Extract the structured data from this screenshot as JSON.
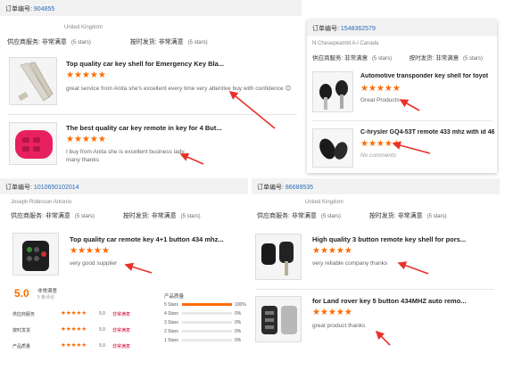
{
  "star_glyph": "★★★★★",
  "accent_color": "#ff6a00",
  "link_color": "#2a6bb8",
  "orders": [
    {
      "order_label": "订单编号:",
      "order_number": "904855",
      "seller": "United Kingdom",
      "service_label": "供应商服务:",
      "service_value": "非常满意",
      "service_stars": "(5 stars)",
      "delivery_label": "按时发货:",
      "delivery_value": "非常满意",
      "delivery_stars": "(5 stars)",
      "items": [
        {
          "title": "Top quality car key shell for Emergency Key Bla...",
          "comment": "great service from Anita she's excellent every time very attentive buy with confidence 😊",
          "thumb_icon": "key-blade-icon"
        },
        {
          "title": "The best quality car key remote in key for 4 But...",
          "comment": "I buy from Anita she is excellent business lady",
          "comment2": "many thanks",
          "thumb_icon": "silicone-key-cover-icon"
        }
      ]
    },
    {
      "order_label": "订单编号:",
      "order_number": "15483625",
      "order_suffix": "79",
      "seller": "N Chesepeambl A-l Canada",
      "service_label": "供应商服务:",
      "service_value": "非常满意",
      "service_stars": "(5 stars)",
      "delivery_label": "按时发货:",
      "delivery_value": "非常满意",
      "delivery_stars": "(5 stars)",
      "items": [
        {
          "title": "Automotive transponder key shell for toyot",
          "comment": "Great Products",
          "thumb_icon": "transponder-key-icon"
        },
        {
          "title": "C-hrysler GQ4-53T remote 433 mhz with id 46 ...",
          "comment": "No comments",
          "thumb_icon": "fob-remote-icon"
        }
      ]
    },
    {
      "order_label": "订单编号:",
      "order_number": "1",
      "order_rest": "01065010201",
      "order_suffix": "4",
      "seller": "Joseph Robinson Antonio",
      "service_label": "供应商服务:",
      "service_value": "非常满意",
      "service_stars": "(5 stars)",
      "delivery_label": "按时发货:",
      "delivery_value": "非常满意",
      "delivery_stars": "(5 stars)",
      "items": [
        {
          "title": "Top quality car remote key 4+1 button 434 mhz...",
          "comment": "very good supplier",
          "thumb_icon": "flip-remote-key-icon"
        }
      ]
    },
    {
      "order_label": "订单编号:",
      "order_number": "86689535",
      "seller": "United Kingdom",
      "service_label": "供应商服务:",
      "service_value": "非常满意",
      "service_stars": "(5 stars)",
      "delivery_label": "按时发货:",
      "delivery_value": "非常满意",
      "delivery_stars": "(5 stars)",
      "items": [
        {
          "title": "High quality 3 button remote key shell for pors...",
          "comment": "very reliable company thanks",
          "thumb_icon": "porsche-key-shell-icon"
        },
        {
          "title": "for Land rover key 5 button 434MHZ auto remo...",
          "comment": "great product thanks",
          "thumb_icon": "land-rover-remote-icon"
        }
      ]
    }
  ],
  "summary": {
    "score": "5.0",
    "score_label": "非常满意",
    "score_sub": "5 条评论",
    "rows": [
      {
        "label": "供应商服务",
        "value": "5.0",
        "badge": "非常满意"
      },
      {
        "label": "按时发货",
        "value": "5.0",
        "badge": "非常满意"
      },
      {
        "label": "产品质量",
        "value": "5.0",
        "badge": "非常满意"
      }
    ],
    "breakdown_title": "产品质量",
    "bars": [
      {
        "label": "5 Stars",
        "pct": "100%",
        "fill": 1.0
      },
      {
        "label": "4 Stars",
        "pct": "0%",
        "fill": 0
      },
      {
        "label": "3 Stars",
        "pct": "0%",
        "fill": 0
      },
      {
        "label": "2 Stars",
        "pct": "0%",
        "fill": 0
      },
      {
        "label": "1 Stars",
        "pct": "0%",
        "fill": 0
      }
    ]
  }
}
